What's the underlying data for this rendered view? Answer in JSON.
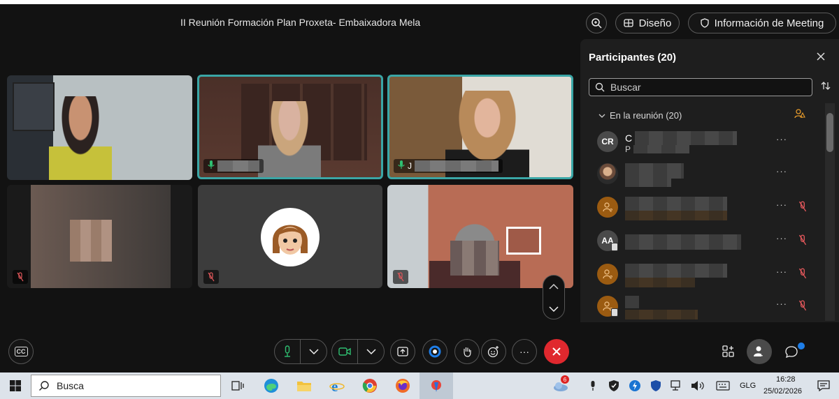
{
  "meeting": {
    "title": "II Reunión Formación Plan Proxeta- Embaixadora Mela"
  },
  "toolbar": {
    "layout_label": "Diseño",
    "info_label": "Información de Meeting"
  },
  "panel": {
    "title": "Participantes (20)",
    "search_placeholder": "Buscar",
    "section_label": "En la reunión (20)",
    "participants": [
      {
        "initials": "CR",
        "name_prefix": "C",
        "sub_prefix": "P",
        "more": "···"
      },
      {
        "initials": "",
        "more": "···"
      },
      {
        "initials": "",
        "more": "···"
      },
      {
        "initials": "AA",
        "more": "···"
      },
      {
        "initials": "",
        "more": "···"
      },
      {
        "initials": "",
        "more": "···"
      }
    ]
  },
  "tiles": [
    {
      "id": "tile-1"
    },
    {
      "id": "tile-2",
      "name_initial": ""
    },
    {
      "id": "tile-3",
      "name_initial": "J"
    },
    {
      "id": "tile-4"
    },
    {
      "id": "tile-5"
    },
    {
      "id": "tile-6"
    }
  ],
  "controls": {
    "cc_label": "CC",
    "more_label": "···"
  },
  "taskbar": {
    "search_label": "Busca",
    "language": "GLG",
    "time": "16:28",
    "date": "25/02/2026",
    "weather_badge": "6"
  },
  "colors": {
    "accent_active": "#3aa6a6",
    "leave": "#e0282e",
    "avatar_orange": "#9b5b11",
    "mute_red": "#e0575a",
    "notify": "#1e7ee8"
  }
}
